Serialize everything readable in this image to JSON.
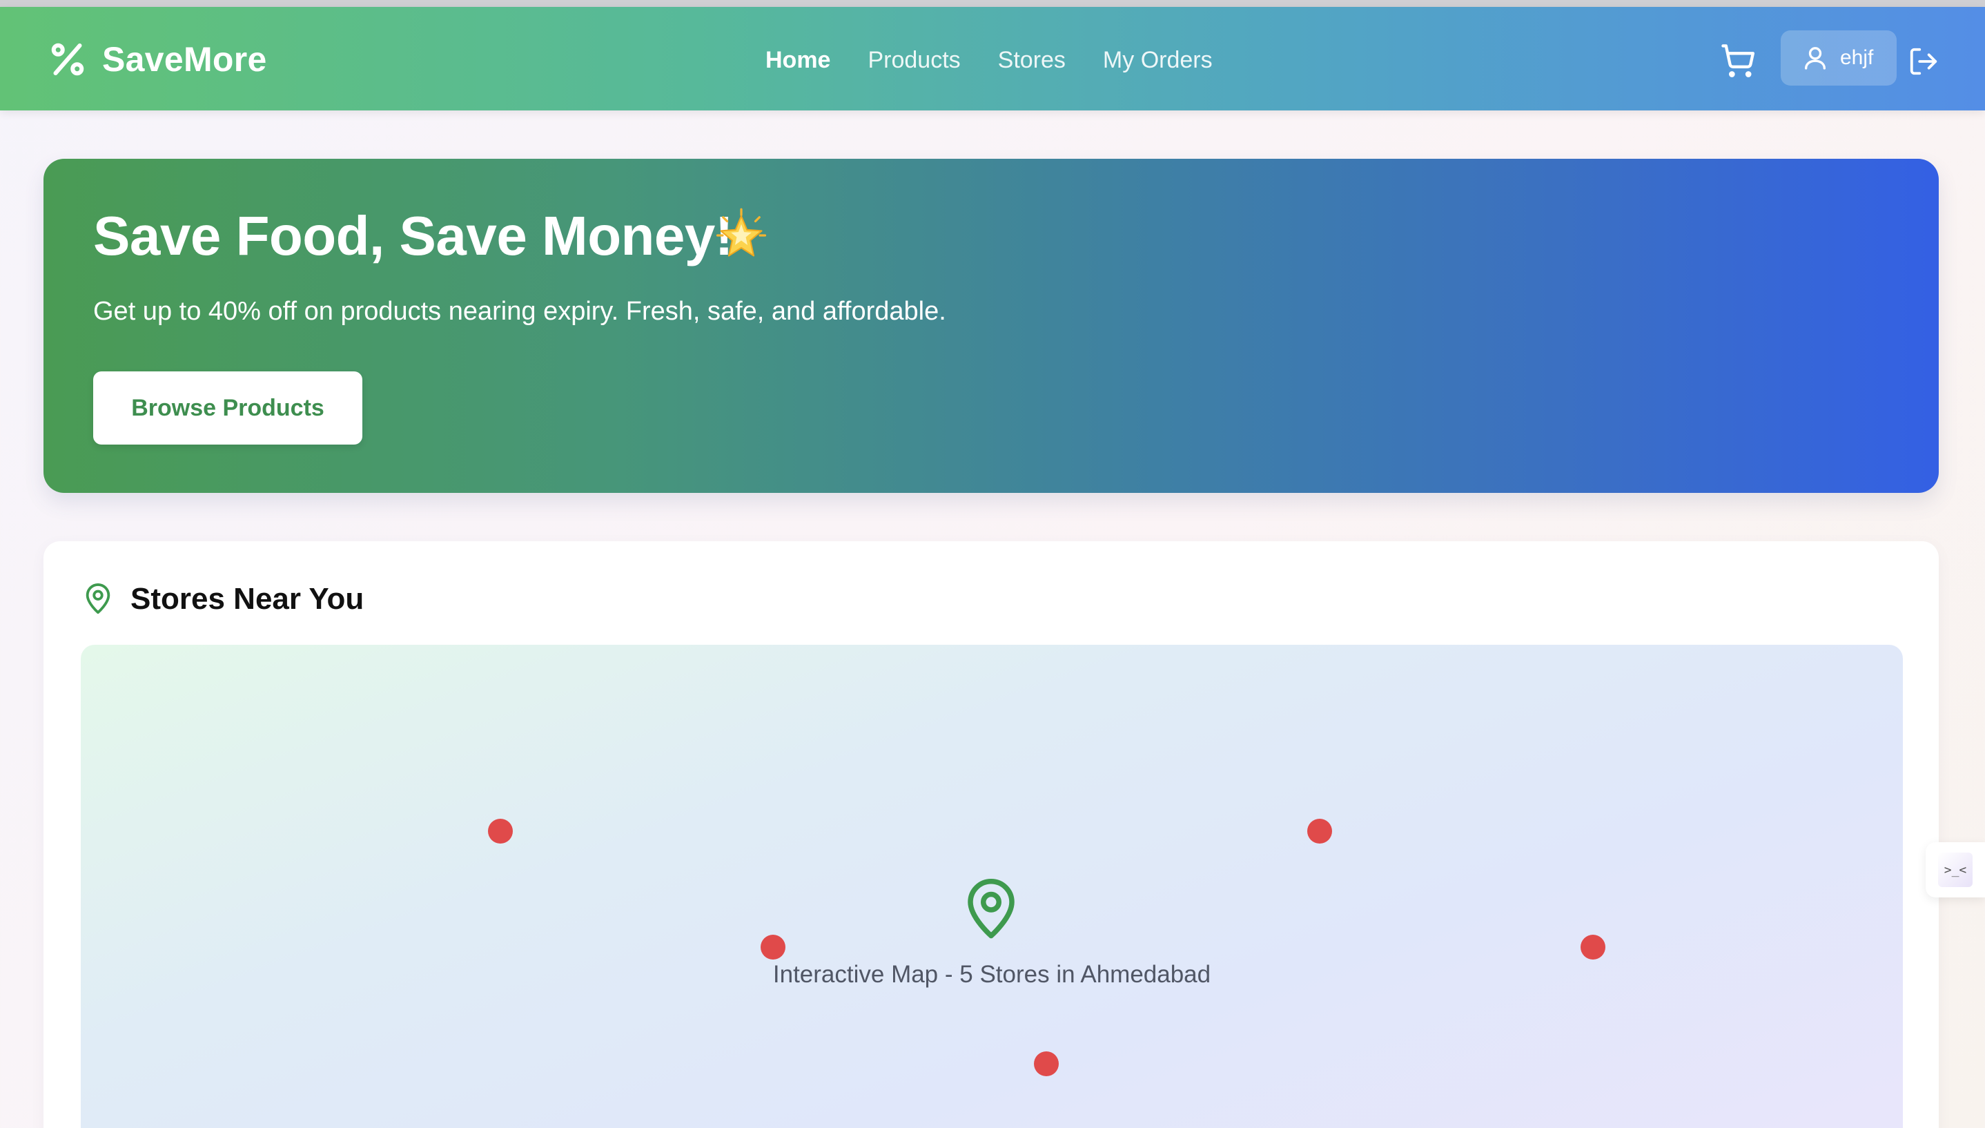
{
  "navbar": {
    "brand": "SaveMore",
    "brand_icon": "percent-icon",
    "links": [
      {
        "label": "Home",
        "active": true
      },
      {
        "label": "Products",
        "active": false
      },
      {
        "label": "Stores",
        "active": false
      },
      {
        "label": "My Orders",
        "active": false
      }
    ],
    "cart_icon": "cart-icon",
    "user": {
      "name": "ehjf",
      "icon": "user-icon"
    },
    "logout_icon": "logout-icon"
  },
  "hero": {
    "title": "Save Food, Save Money!",
    "emoji": "glowing-star",
    "subtitle": "Get up to 40% off on products nearing expiry. Fresh, safe, and affordable.",
    "cta_label": "Browse Products"
  },
  "stores": {
    "title": "Stores Near You",
    "icon": "map-pin-icon",
    "map_caption": "Interactive Map - 5 Stores in Ahmedabad",
    "marker_count": 5
  },
  "side_widget": {
    "glyph": ">_<"
  },
  "colors": {
    "nav_start": "#62c276",
    "nav_end": "#548ee6",
    "hero_start": "#4a9b54",
    "hero_end": "#3460e4",
    "accent_green": "#3e8e4f",
    "marker_red": "#e04a4a"
  }
}
